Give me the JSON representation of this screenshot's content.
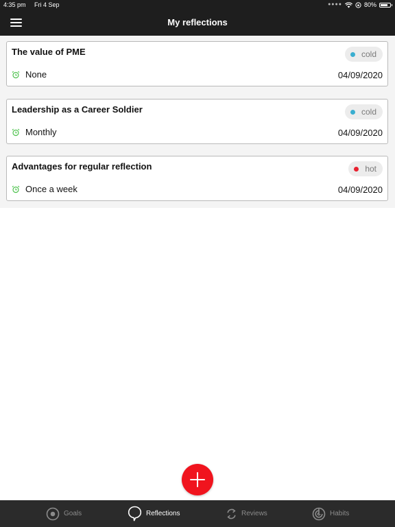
{
  "status_bar": {
    "time": "4:35 pm",
    "date": "Fri 4 Sep",
    "battery_text": "80%",
    "battery_level": 0.8
  },
  "header": {
    "title": "My reflections",
    "menu_icon": "hamburger-menu-icon"
  },
  "colors": {
    "cold": "#3aaed0",
    "hot": "#e8212f",
    "alarm_icon": "#4ec24e",
    "fab": "#f0141e",
    "header_bg": "#1e1e1e",
    "tab_bar_bg": "#2b2b2b"
  },
  "reflections": [
    {
      "title": "The value of PME",
      "temperature": "cold",
      "frequency": "None",
      "date": "04/09/2020"
    },
    {
      "title": "Leadership as a Career Soldier",
      "temperature": "cold",
      "frequency": "Monthly",
      "date": "04/09/2020"
    },
    {
      "title": "Advantages for regular reflection",
      "temperature": "hot",
      "frequency": "Once a week",
      "date": "04/09/2020"
    }
  ],
  "fab": {
    "icon": "plus-icon"
  },
  "tabs": [
    {
      "label": "Goals",
      "icon": "target-icon",
      "active": false
    },
    {
      "label": "Reflections",
      "icon": "speech-bubble-icon",
      "active": true
    },
    {
      "label": "Reviews",
      "icon": "refresh-icon",
      "active": false
    },
    {
      "label": "Habits",
      "icon": "habits-icon",
      "active": false
    }
  ]
}
